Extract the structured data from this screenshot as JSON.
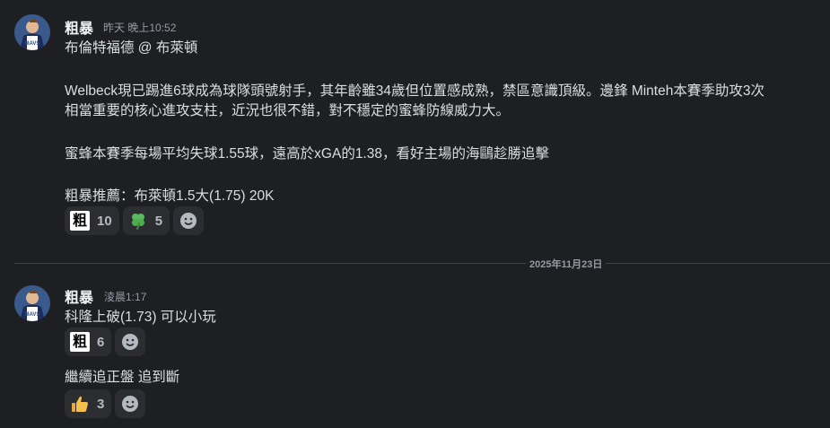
{
  "messages": [
    {
      "username": "粗暴",
      "timestamp": "昨天 晚上10:52",
      "lines": [
        "布倫特福德 @ 布萊頓",
        "",
        "Welbeck現已踢進6球成為球隊頭號射手，其年齡雖34歲但位置感成熟，禁區意識頂級。邊鋒 Minteh本賽季助攻3次",
        "相當重要的核心進攻支柱，近況也很不錯，對不穩定的蜜蜂防線威力大。",
        "",
        "蜜蜂本賽季每場平均失球1.55球，遠高於xGA的1.38，看好主場的海鷗趁勝追擊",
        "",
        "粗暴推薦：布萊頓1.5大(1.75) 20K"
      ],
      "reactions": [
        {
          "emoji": "粗",
          "icon": "cu-character-emoji",
          "count": "10"
        },
        {
          "emoji": "clover",
          "icon": "four-leaf-clover-icon",
          "count": "5"
        }
      ]
    },
    {
      "username": "粗暴",
      "timestamp": "淩晨1:17",
      "lines": [
        "科隆上破(1.73) 可以小玩"
      ],
      "reactions": [
        {
          "emoji": "粗",
          "icon": "cu-character-emoji",
          "count": "6"
        }
      ],
      "followup": {
        "text": "繼續追正盤  追到斷",
        "reactions": [
          {
            "emoji": "thumbs-up",
            "icon": "thumbs-up-icon",
            "count": "3"
          }
        ]
      }
    }
  ],
  "date_divider": "2025年11月23日",
  "colors": {
    "background": "#1e1f22",
    "reaction_bg": "#2b2d31",
    "text": "#dbdee1",
    "muted": "#949ba4"
  }
}
